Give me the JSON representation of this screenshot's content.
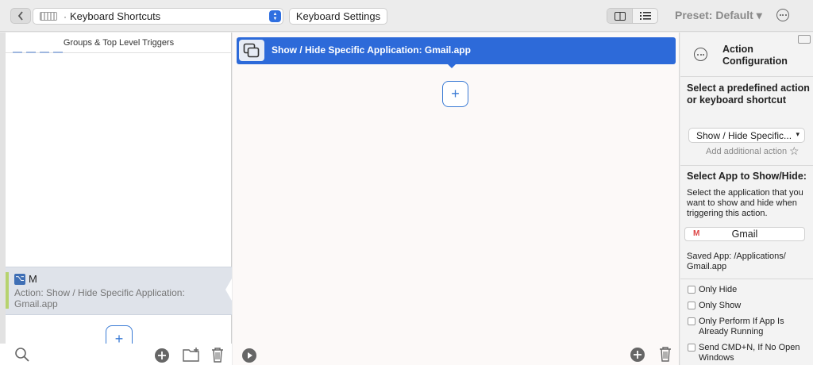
{
  "toolbar": {
    "app_selector": "Keyboard Shortcuts",
    "keyboard_settings": "Keyboard Settings",
    "preset": "Preset: Default ▾"
  },
  "left": {
    "header": "Groups & Top Level Triggers",
    "trigger": {
      "key": "M",
      "description": "Action: Show / Hide Specific Application: Gmail.app"
    }
  },
  "middle": {
    "action_label": "Show / Hide Specific Application: Gmail.app"
  },
  "right": {
    "title": "Action Configuration",
    "predefined_heading": "Select a predefined action or keyboard shortcut",
    "predefined_value": "Show / Hide Specific...",
    "add_additional": "Add additional action",
    "app_heading": "Select App to Show/Hide:",
    "app_description": "Select the application that you want to show and hide when triggering this action.",
    "app_button": "Gmail",
    "saved_app": "Saved App: /Applications/ Gmail.app",
    "options": [
      "Only Hide",
      "Only Show",
      "Only Perform If App Is Already Running",
      "Send CMD+N, If No Open Windows"
    ]
  },
  "colors": {
    "accent": "#2d6ad9",
    "selection": "#dfe3ea"
  }
}
